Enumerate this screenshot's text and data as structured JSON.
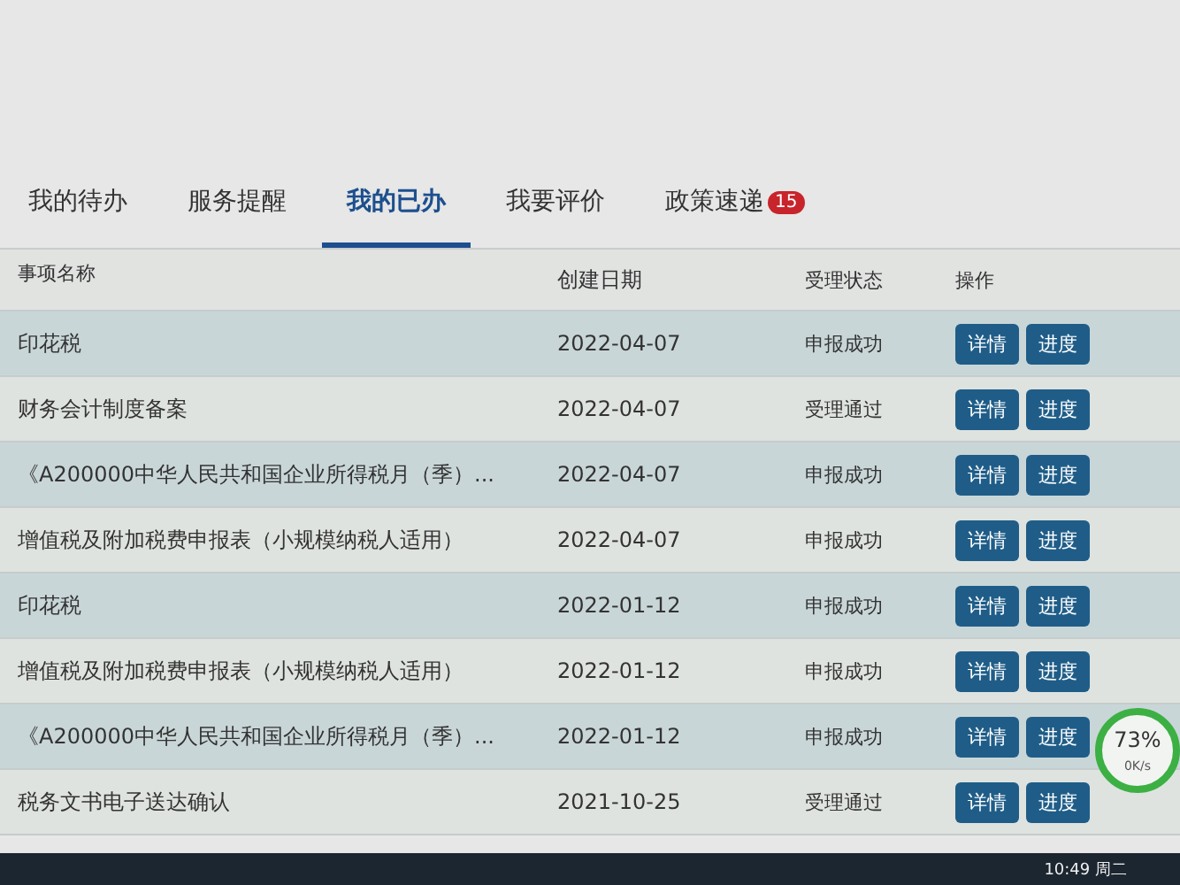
{
  "tabs": [
    {
      "label": "我的待办",
      "selected": false
    },
    {
      "label": "服务提醒",
      "selected": false
    },
    {
      "label": "我的已办",
      "selected": true
    },
    {
      "label": "我要评价",
      "selected": false
    },
    {
      "label": "政策速递",
      "selected": false,
      "badge": "15"
    }
  ],
  "table": {
    "columns": [
      "事项名称",
      "创建日期",
      "受理状态",
      "操作"
    ],
    "rows": [
      {
        "name": "印花税",
        "date": "2022-04-07",
        "status": "申报成功",
        "actions": [
          "详情",
          "进度"
        ]
      },
      {
        "name": "财务会计制度备案",
        "date": "2022-04-07",
        "status": "受理通过",
        "actions": [
          "详情",
          "进度"
        ]
      },
      {
        "name": "《A200000中华人民共和国企业所得税月（季）...",
        "date": "2022-04-07",
        "status": "申报成功",
        "actions": [
          "详情",
          "进度"
        ]
      },
      {
        "name": "增值税及附加税费申报表（小规模纳税人适用）",
        "date": "2022-04-07",
        "status": "申报成功",
        "actions": [
          "详情",
          "进度"
        ]
      },
      {
        "name": "印花税",
        "date": "2022-01-12",
        "status": "申报成功",
        "actions": [
          "详情",
          "进度"
        ]
      },
      {
        "name": "增值税及附加税费申报表（小规模纳税人适用）",
        "date": "2022-01-12",
        "status": "申报成功",
        "actions": [
          "详情",
          "进度"
        ]
      },
      {
        "name": "《A200000中华人民共和国企业所得税月（季）...",
        "date": "2022-01-12",
        "status": "申报成功",
        "actions": [
          "详情",
          "进度"
        ]
      },
      {
        "name": "税务文书电子送达确认",
        "date": "2021-10-25",
        "status": "受理通过",
        "actions": [
          "详情",
          "进度"
        ]
      }
    ]
  },
  "speed_widget": {
    "percent": "73%",
    "rate": "0K/s"
  },
  "taskbar": {
    "clock": "10:49 周二"
  }
}
